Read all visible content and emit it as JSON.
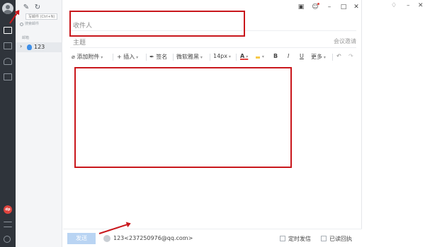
{
  "sidebar_rail": {
    "badge_text": "dp",
    "icons": [
      "avatar-icon",
      "mail-icon",
      "note-icon",
      "contacts-icon",
      "calendar-icon",
      "app-badge-icon",
      "menu-icon",
      "settings-icon"
    ]
  },
  "folder_panel": {
    "tooltip": "写邮件 (Ctrl+N)",
    "search_placeholder": "搜索邮件",
    "section_label": "邮箱",
    "account_label": "123"
  },
  "compose": {
    "recipient_placeholder": "收件人",
    "subject_placeholder": "主题",
    "meeting_invite": "会议邀请",
    "toolbar": {
      "attach": "添加附件",
      "insert": "插入",
      "signature": "签名",
      "font": "微软雅黑",
      "size": "14px",
      "color": "A",
      "bold": "B",
      "italic": "I",
      "underline": "U",
      "more": "更多"
    },
    "send": "发送",
    "sender": "123<237250976@qq.com>",
    "scheduled_send": "定时发信",
    "read_receipt": "已读回执"
  },
  "colors": {
    "rail": "#2f343b",
    "send_button": "#b9d4f3",
    "annotation": "#c9171c"
  }
}
